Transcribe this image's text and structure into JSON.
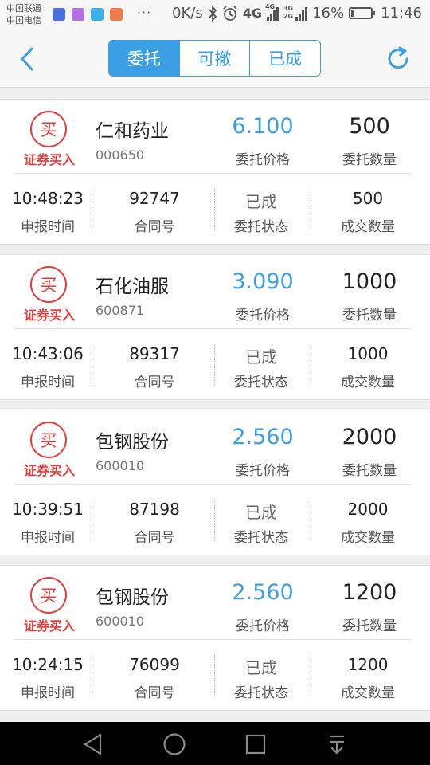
{
  "status_bar": {
    "carrier_1": "中国联通",
    "carrier_2": "中国电信",
    "dots": "···",
    "speed": "0K/s",
    "network_4g": "4G",
    "network_4g_small": "4G",
    "network_3g": "3G",
    "network_2g": "2G",
    "battery_percent": "16%",
    "battery_level": 0.16,
    "time": "11:46"
  },
  "nav": {
    "tabs": [
      "委托",
      "可撤",
      "已成"
    ],
    "active_tab": 0,
    "accent_color": "#3a9fe4"
  },
  "labels": {
    "price": "委托价格",
    "quantity": "委托数量",
    "time": "申报时间",
    "contract": "合同号",
    "status": "委托状态",
    "filled": "成交数量"
  },
  "orders": [
    {
      "badge": "买",
      "action": "证券买入",
      "name": "仁和药业",
      "code": "000650",
      "price": "6.100",
      "quantity": "500",
      "time": "10:48:23",
      "contract": "92747",
      "status": "已成",
      "filled": "500"
    },
    {
      "badge": "买",
      "action": "证券买入",
      "name": "石化油服",
      "code": "600871",
      "price": "3.090",
      "quantity": "1000",
      "time": "10:43:06",
      "contract": "89317",
      "status": "已成",
      "filled": "1000"
    },
    {
      "badge": "买",
      "action": "证券买入",
      "name": "包钢股份",
      "code": "600010",
      "price": "2.560",
      "quantity": "2000",
      "time": "10:39:51",
      "contract": "87198",
      "status": "已成",
      "filled": "2000"
    },
    {
      "badge": "买",
      "action": "证券买入",
      "name": "包钢股份",
      "code": "600010",
      "price": "2.560",
      "quantity": "1200",
      "time": "10:24:15",
      "contract": "76099",
      "status": "已成",
      "filled": "1200"
    }
  ],
  "icons": {
    "back": "chevron-left-icon",
    "refresh": "refresh-icon",
    "android_back": "triangle-back-icon",
    "android_home": "circle-home-icon",
    "android_recent": "square-recent-icon",
    "android_menu": "down-arrow-icon"
  }
}
